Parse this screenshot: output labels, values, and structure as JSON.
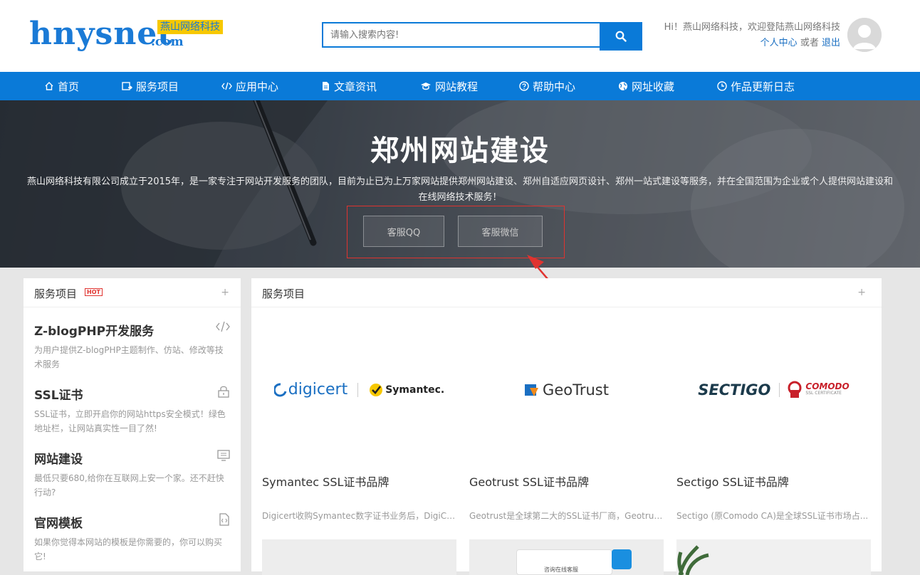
{
  "header": {
    "logo_text": "hnysnet",
    "logo_sub": "燕山网络科技",
    "logo_com": ".com",
    "search_placeholder": "请输入搜索内容!",
    "greeting": "Hi！燕山网络科技，欢迎登陆燕山网络科技",
    "user_center": "个人中心",
    "or": "或者",
    "logout": "退出"
  },
  "nav": {
    "items": [
      {
        "label": "首页",
        "icon": "home-icon"
      },
      {
        "label": "服务项目",
        "icon": "external-box-icon"
      },
      {
        "label": "应用中心",
        "icon": "code-icon"
      },
      {
        "label": "文章资讯",
        "icon": "document-icon"
      },
      {
        "label": "网站教程",
        "icon": "graduation-cap-icon"
      },
      {
        "label": "帮助中心",
        "icon": "question-circle-icon"
      },
      {
        "label": "网址收藏",
        "icon": "globe-icon"
      },
      {
        "label": "作品更新日志",
        "icon": "clock-icon"
      }
    ]
  },
  "hero": {
    "title": "郑州网站建设",
    "description": "燕山网络科技有限公司成立于2015年，是一家专注于网站开发服务的团队，目前为止已为上万家网站提供郑州网站建设、郑州自适应网页设计、郑州一站式建设等服务，并在全国范围为企业或个人提供网站建设和在线网络技术服务！",
    "btn_qq": "客服QQ",
    "btn_wechat": "客服微信"
  },
  "sidebar": {
    "title": "服务项目",
    "hot": "HOT",
    "plus": "+",
    "services": [
      {
        "title": "Z-blogPHP开发服务",
        "desc": "为用户提供Z-blogPHP主题制作、仿站、修改等技术服务",
        "icon": "code-icon"
      },
      {
        "title": "SSL证书",
        "desc": "SSL证书，立即开启你的网站https安全模式！绿色地址栏，让网站真实性一目了然!",
        "icon": "lock-icon"
      },
      {
        "title": "网站建设",
        "desc": "最低只要680,给你在互联网上安一个家。还不赶快行动?",
        "icon": "monitor-icon"
      },
      {
        "title": "官网模板",
        "desc": "如果你觉得本网站的模板是你需要的，你可以购买它!",
        "icon": "code-file-icon"
      }
    ]
  },
  "main": {
    "title": "服务项目",
    "plus": "+",
    "cards": [
      {
        "title": "Symantec SSL证书品牌",
        "desc": "Digicert收购Symantec数字证书业务后，DigiCert...",
        "logo_a": "digicert",
        "logo_b": "Symantec."
      },
      {
        "title": "Geotrust SSL证书品牌",
        "desc": "Geotrust是全球第二大的SSL证书厂商，Geotrust...",
        "logo_a": "GeoTrust"
      },
      {
        "title": "Sectigo SSL证书品牌",
        "desc": "Sectigo (原Comodo CA)是全球SSL证书市场占...",
        "logo_a": "SECTIGO",
        "logo_b": "COMODO",
        "logo_b_sub": "SSL CERTIFICATE"
      }
    ],
    "chat_preview_text": "咨询在线客服"
  }
}
